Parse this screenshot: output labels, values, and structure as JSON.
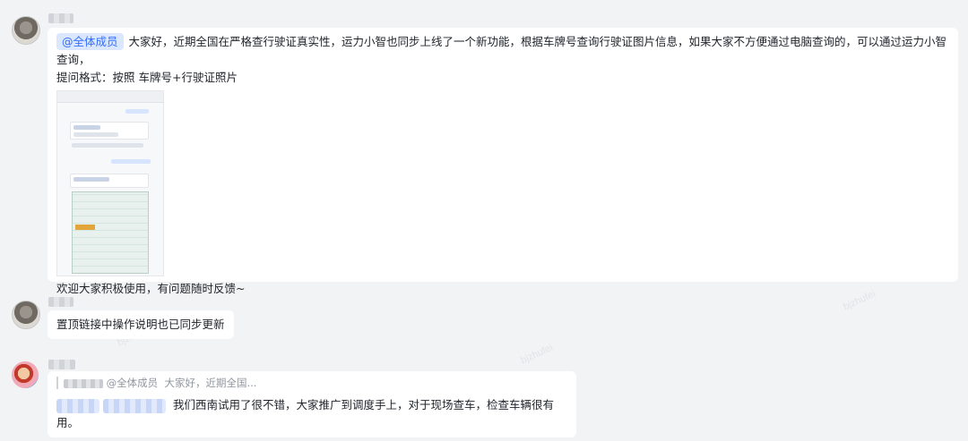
{
  "watermark": "bjzhufei",
  "messages": [
    {
      "mention": "@全体成员",
      "text_line1": "大家好，近期全国在严格查行驶证真实性，运力小智也同步上线了一个新功能，根据车牌号查询行驶证图片信息，如果大家不方便通过电脑查询的，可以通过运力小智查询，",
      "text_line2": "提问格式：按照  车牌号+行驶证照片",
      "footer": "欢迎大家积极使用，有问题随时反馈~"
    },
    {
      "text": "置顶链接中操作说明也已同步更新"
    },
    {
      "quote_mention": "@全体成员",
      "quote_text": "大家好，近期全国...",
      "text": "我们西南试用了很不错，大家推广到调度手上，对于现场查车，检查车辆很有用。"
    }
  ]
}
